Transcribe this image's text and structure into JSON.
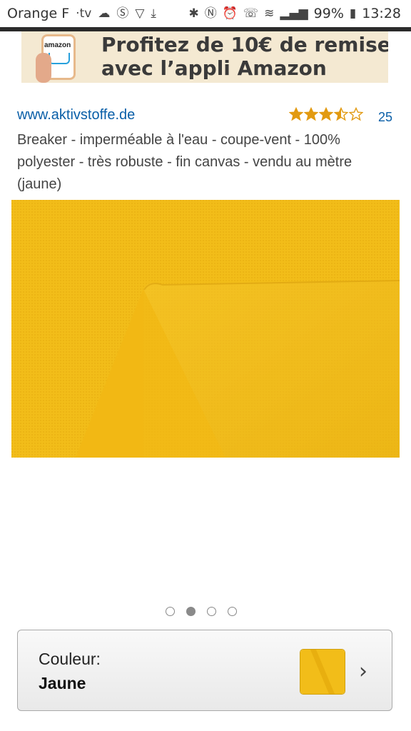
{
  "status_bar": {
    "carrier": "Orange F",
    "tv_label": "·tv",
    "battery": "99%",
    "time": "13:28"
  },
  "banner": {
    "line1": "Profitez de 10€ de remise",
    "line2": "avec l’appli Amazon",
    "phone_logo": "amazon"
  },
  "product": {
    "seller": "www.aktivstoffe.de",
    "rating": 3.5,
    "review_count": "25",
    "title": "Breaker - imperméable à l'eau - coupe-vent - 100% polyester - très robuste - fin canvas - vendu au mètre (jaune)"
  },
  "gallery": {
    "total": 4,
    "active_index": 1
  },
  "color_selector": {
    "label": "Couleur:",
    "value": "Jaune",
    "swatch_color": "#f2bd19"
  },
  "colors": {
    "link": "#0a5fa8",
    "star": "#e29a11",
    "fabric": "#f2bd19"
  }
}
